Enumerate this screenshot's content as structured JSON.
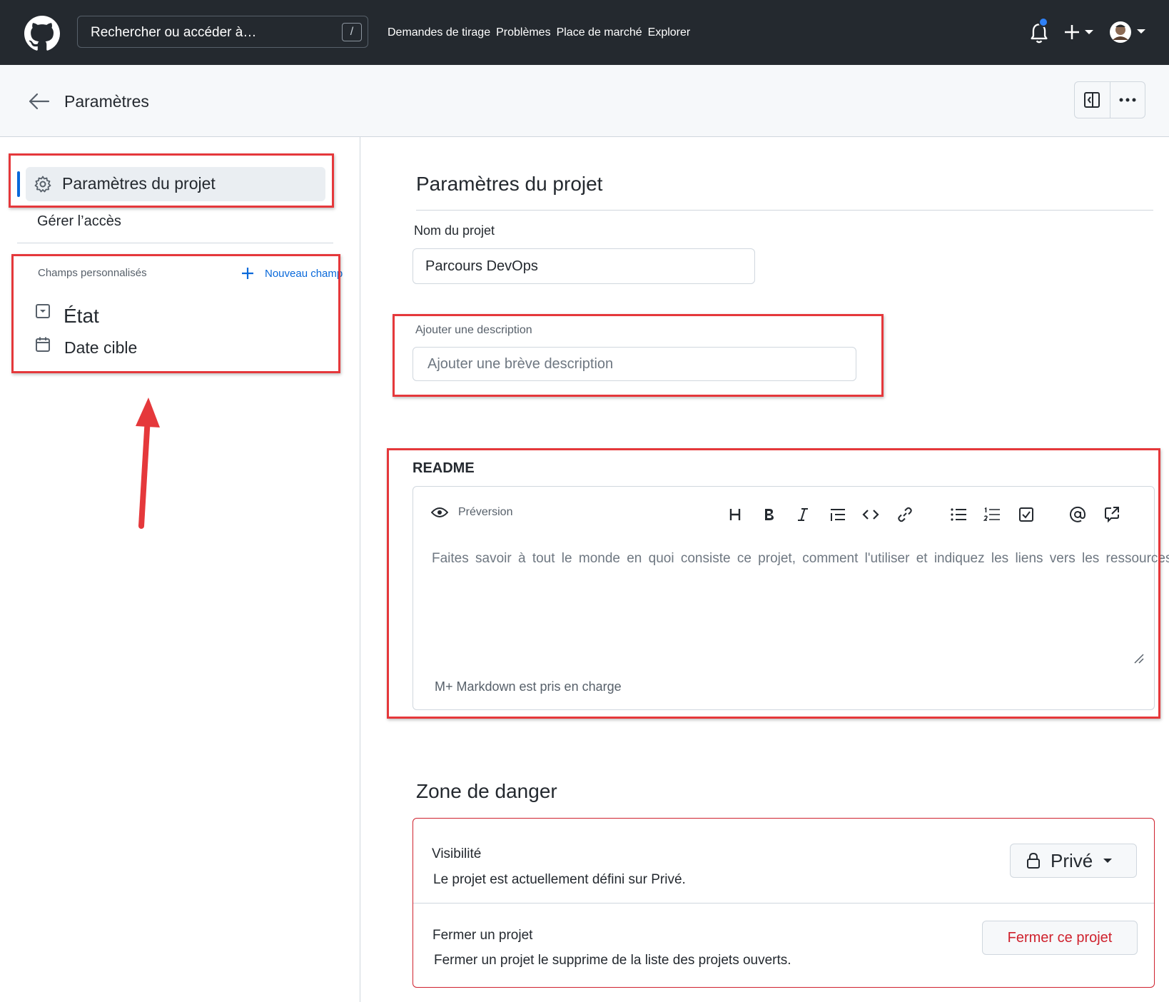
{
  "header": {
    "search_placeholder": "Rechercher ou accéder à…",
    "search_shortcut": "/",
    "nav": [
      "Demandes de tirage",
      "Problèmes",
      "Place de marché",
      "Explorer"
    ]
  },
  "subheader": {
    "title": "Paramètres"
  },
  "sidebar": {
    "active_item": "Paramètres du projet",
    "access_item": "Gérer l’accès",
    "fields_header": "Champs personnalisés",
    "new_field_label": "Nouveau champ",
    "fields": [
      {
        "label": "État",
        "icon": "single-select-icon"
      },
      {
        "label": "Date cible",
        "icon": "calendar-icon"
      }
    ]
  },
  "main": {
    "title": "Paramètres du projet",
    "name_label": "Nom du projet",
    "name_value": "Parcours DevOps",
    "description_label": "Ajouter une description",
    "description_placeholder": "Ajouter une brève description",
    "readme_title": "README",
    "preview_label": "Préversion",
    "readme_placeholder": "Faites savoir à tout le monde en quoi consiste ce projet, comment l'utiliser et indiquez les liens vers les ressources",
    "markdown_note": "M+ Markdown est pris en charge",
    "toolbar": [
      "heading-icon",
      "bold-icon",
      "italic-icon",
      "quote-icon",
      "code-icon",
      "link-icon",
      "bulleted-list-icon",
      "numbered-list-icon",
      "task-list-icon",
      "mention-icon",
      "reference-icon"
    ]
  },
  "danger": {
    "title": "Zone de danger",
    "visibility_heading": "Visibilité",
    "visibility_text": "Le projet est actuellement défini sur Privé.",
    "visibility_button": "Privé",
    "close_heading": "Fermer un projet",
    "close_text": "Fermer un projet le supprime de la liste des projets ouverts.",
    "close_button": "Fermer ce projet"
  },
  "colors": {
    "header_bg": "#24292f",
    "accent": "#0969da",
    "danger": "#cf222e",
    "annotation": "#e5383b"
  }
}
